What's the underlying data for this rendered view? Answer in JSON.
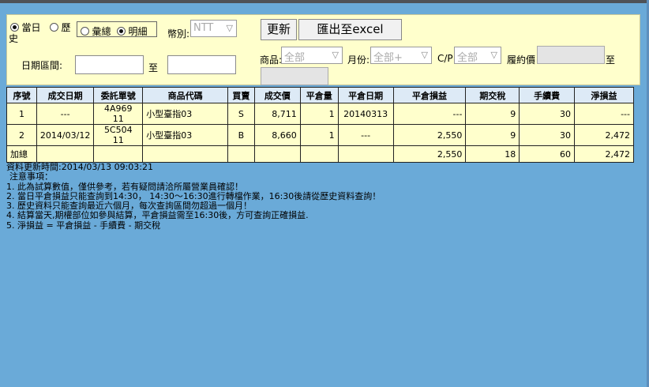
{
  "filters": {
    "radio_today": "當日",
    "radio_history_1": "歷",
    "radio_history_2": "史",
    "radio_summary": "彙總",
    "radio_detail": "明細",
    "currency_label": "幣別:",
    "currency_value": "NTT",
    "date_range_label": "日期區間:",
    "date_to": "至",
    "product_label": "商品:",
    "product_value": "全部",
    "month_label": "月份:",
    "month_value": "全部+",
    "cp_label": "C/P",
    "cp_value": "全部",
    "strike_label": "履約價",
    "strike_to": "至"
  },
  "buttons": {
    "refresh": "更新",
    "export": "匯出至excel"
  },
  "table": {
    "headers": [
      "序號",
      "成交日期",
      "委託單號",
      "商品代碼",
      "買賣",
      "成交價",
      "平倉量",
      "平倉日期",
      "平倉損益",
      "期交稅",
      "手續費",
      "淨損益"
    ],
    "rows": [
      [
        "1",
        "---",
        "4A969 11",
        "小型臺指03",
        "S",
        "8,711",
        "1",
        "20140313",
        "---",
        "9",
        "30",
        "---"
      ],
      [
        "2",
        "2014/03/12",
        "5C504 11",
        "小型臺指03",
        "B",
        "8,660",
        "1",
        "---",
        "2,550",
        "9",
        "30",
        "2,472"
      ]
    ],
    "total": [
      "加總",
      "",
      "",
      "",
      "",
      "",
      "",
      "",
      "2,550",
      "18",
      "60",
      "2,472"
    ]
  },
  "notes": {
    "update_time": "資料更新時間:2014/03/13 09:03:21",
    "title": "注意事項：",
    "lines": [
      "1. 此為試算數值，僅供參考，若有疑問請洽所屬營業員確認！",
      "2. 當日平倉損益只能查詢到14:30， 14:30～16:30進行轉檔作業，16:30後請從歷史資料查詢！",
      "3. 歷史資料只能查詢最近六個月，每次查詢區間勿超過一個月！",
      "4. 結算當天,期權部位如參與結算，平倉損益需至16:30後，方可查詢正確損益.",
      "5. 淨損益 = 平倉損益 - 手續費 - 期交稅"
    ]
  }
}
